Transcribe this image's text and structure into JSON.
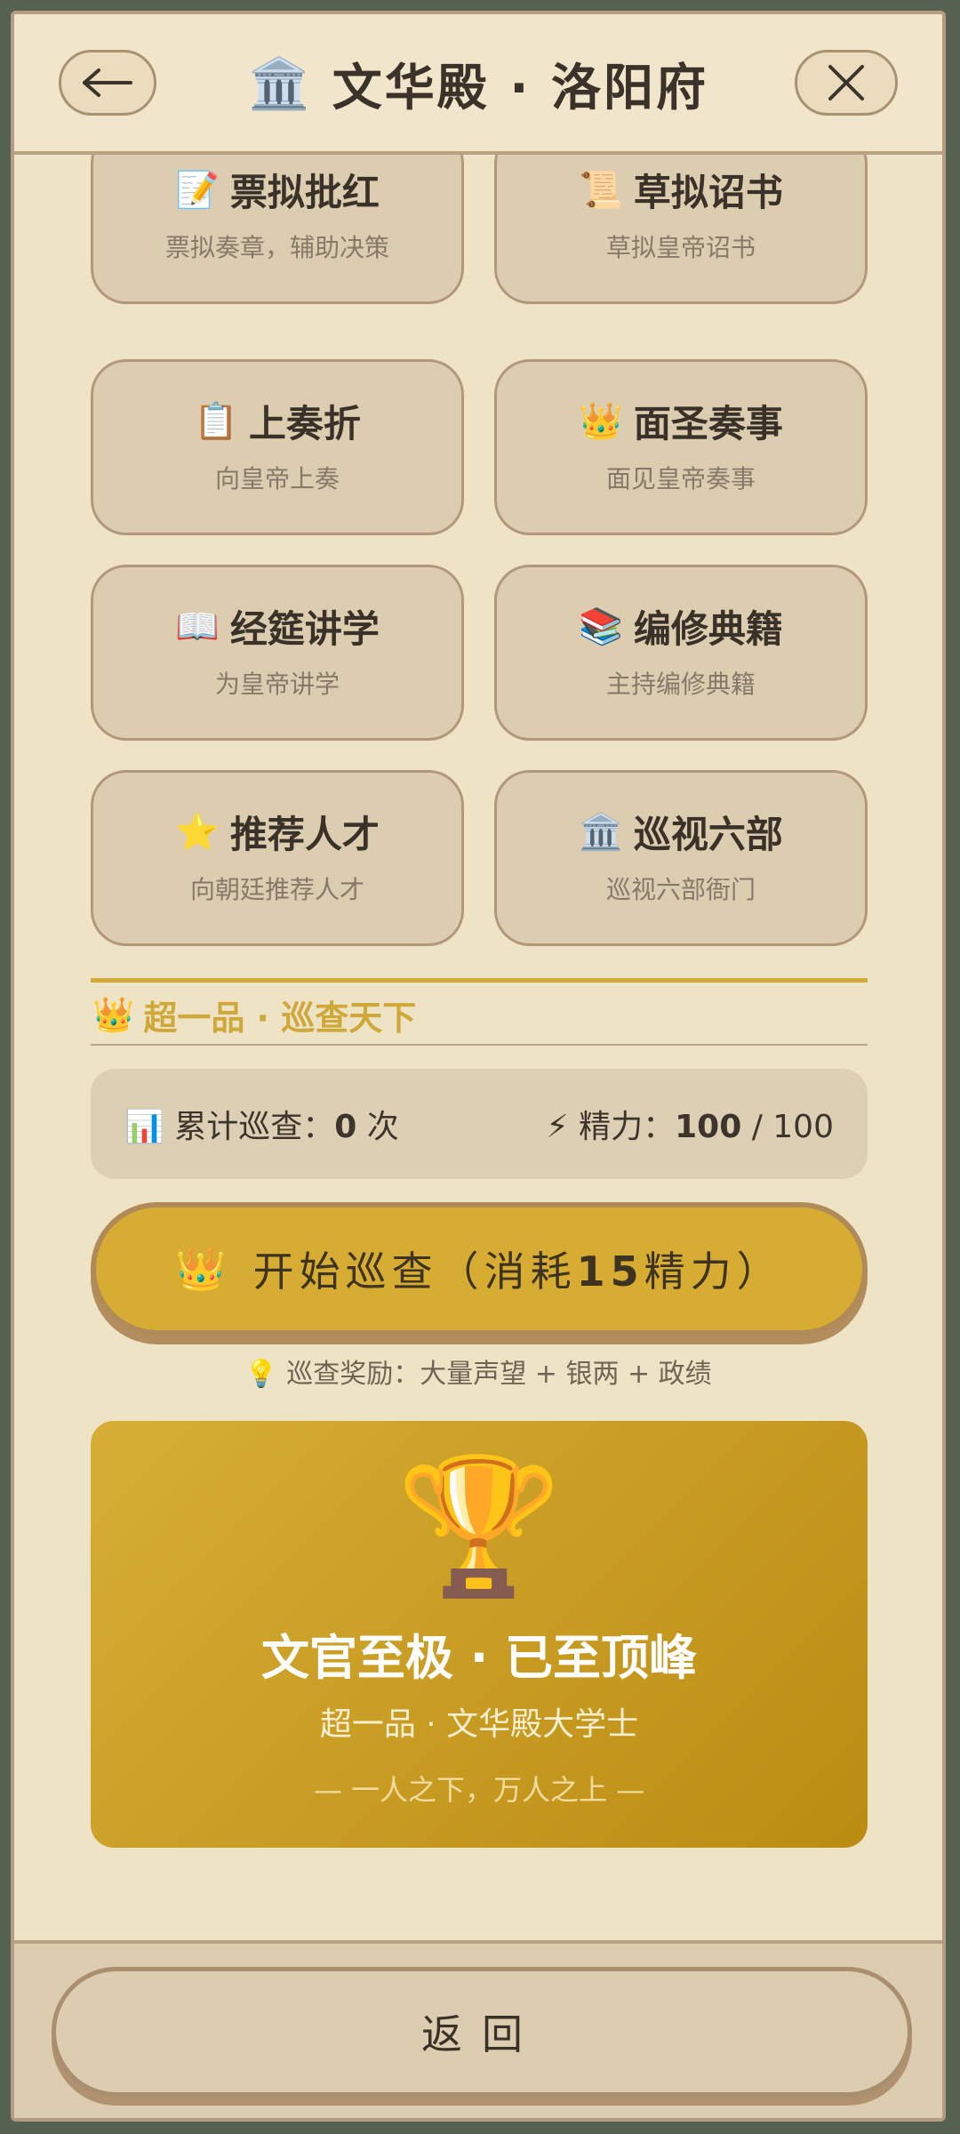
{
  "header": {
    "title": "文华殿 · 洛阳府",
    "title_icon": "🏛️",
    "back_icon": "back-arrow-icon",
    "close_icon": "close-icon"
  },
  "actions": [
    {
      "icon": "📝",
      "title": "票拟批红",
      "subtitle": "票拟奏章，辅助决策"
    },
    {
      "icon": "📜",
      "title": "草拟诏书",
      "subtitle": "草拟皇帝诏书"
    },
    {
      "icon": "📋",
      "title": "上奏折",
      "subtitle": "向皇帝上奏"
    },
    {
      "icon": "👑",
      "title": "面圣奏事",
      "subtitle": "面见皇帝奏事"
    },
    {
      "icon": "📖",
      "title": "经筵讲学",
      "subtitle": "为皇帝讲学"
    },
    {
      "icon": "📚",
      "title": "编修典籍",
      "subtitle": "主持编修典籍"
    },
    {
      "icon": "⭐",
      "title": "推荐人才",
      "subtitle": "向朝廷推荐人才"
    },
    {
      "icon": "🏛️",
      "title": "巡视六部",
      "subtitle": "巡视六部衙门"
    }
  ],
  "section": {
    "icon": "👑",
    "title": "超一品 · 巡查天下"
  },
  "stats": {
    "count_icon": "📊",
    "count_label": "累计巡查：",
    "count_value": "0",
    "count_unit": " 次",
    "energy_icon": "⚡",
    "energy_label": "精力：",
    "energy_value": "100",
    "energy_max": " / 100"
  },
  "start_button": {
    "icon": "👑",
    "label_a": "开始巡查（消耗",
    "label_b": "15",
    "label_c": "精力）"
  },
  "tip": {
    "icon": "💡",
    "text": "巡查奖励：大量声望 + 银两 + 政绩"
  },
  "peak": {
    "icon": "🏆",
    "title": "文官至极 · 已至顶峰",
    "subtitle": "超一品 · 文华殿大学士",
    "motto": "— 一人之下，万人之上 —"
  },
  "footer": {
    "return_label": "返回"
  },
  "colors": {
    "accent_gold": "#d6ac33",
    "frame": "#556252",
    "parchment": "#efe3c6"
  }
}
